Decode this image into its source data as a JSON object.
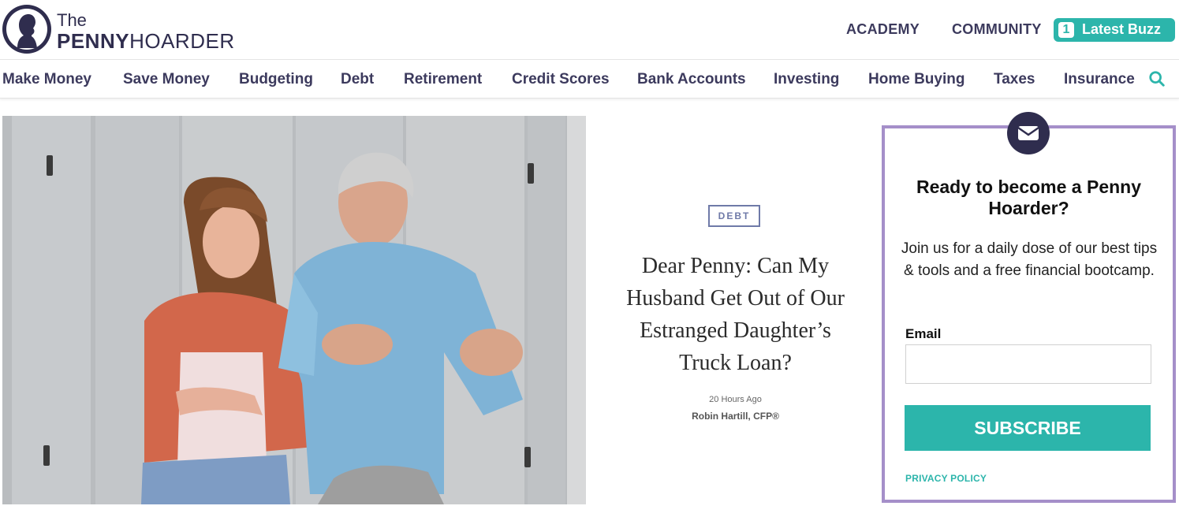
{
  "header": {
    "logo": {
      "the": "The",
      "penny": "PENNY",
      "hoarder": "HOARDER"
    },
    "links": [
      {
        "label": "ACADEMY"
      },
      {
        "label": "COMMUNITY"
      }
    ],
    "buzz": {
      "count": "1",
      "label": "Latest Buzz"
    }
  },
  "nav": {
    "items": [
      {
        "label": "Make Money"
      },
      {
        "label": "Save Money"
      },
      {
        "label": "Budgeting"
      },
      {
        "label": "Debt"
      },
      {
        "label": "Retirement"
      },
      {
        "label": "Credit Scores"
      },
      {
        "label": "Bank Accounts"
      },
      {
        "label": "Investing"
      },
      {
        "label": "Home Buying"
      },
      {
        "label": "Taxes"
      },
      {
        "label": "Insurance"
      }
    ],
    "search_icon": "search-icon"
  },
  "article": {
    "tag": "DEBT",
    "headline": "Dear Penny: Can My Husband Get Out of Our Estranged Daughter’s Truck Loan?",
    "time": "20 Hours Ago",
    "author": "Robin Hartill, CFP®"
  },
  "signup": {
    "icon": "envelope-icon",
    "title": "Ready to become a Penny Hoarder?",
    "description": "Join us for a daily dose of our best tips & tools and a free financial bootcamp.",
    "email_label": "Email",
    "email_value": "",
    "email_placeholder": "",
    "subscribe_label": "SUBSCRIBE",
    "privacy_label": "PRIVACY POLICY"
  },
  "colors": {
    "brand_dark": "#2f2d4e",
    "accent_teal": "#2cb5ab",
    "signup_border": "#a58fc9",
    "tag_blue": "#6f7aa8"
  }
}
